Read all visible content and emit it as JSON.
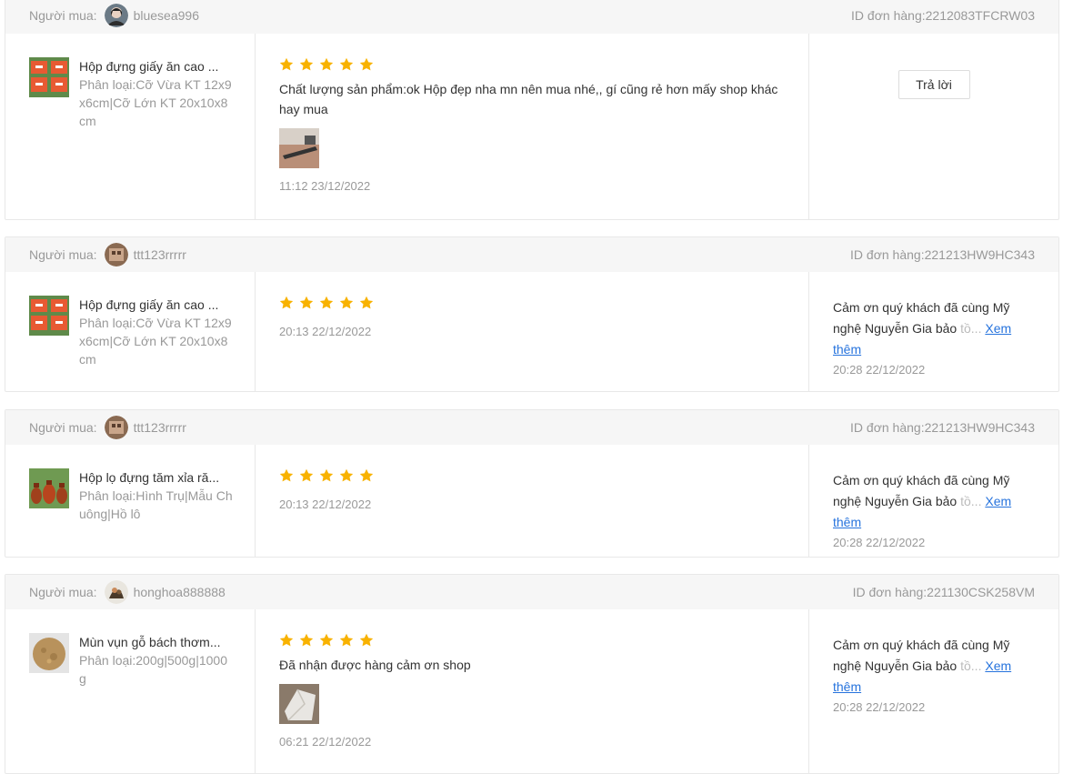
{
  "labels": {
    "buyer": "Người mua:",
    "order_prefix": "ID đơn hàng:",
    "reply_button": "Trả lời",
    "see_more": "Xem thêm"
  },
  "colors": {
    "star": "#f8b200",
    "link": "#2673dd"
  },
  "reviews": [
    {
      "buyer": "bluesea996",
      "order_id": "2212083TFCRW03",
      "product_name": "Hộp đựng giấy ăn cao ...",
      "variant": "Phân loại:Cỡ Vừa KT 12x9x6cm|Cỡ Lớn KT 20x10x8cm",
      "stars": 5,
      "text": "Chất lượng sản phẩm:ok Hộp đẹp nha mn nên mua nhé,, gí cũng rẻ hơn mấy shop khác hay mua",
      "has_image": true,
      "time": "11:12 23/12/2022",
      "reply": null
    },
    {
      "buyer": "ttt123rrrrr",
      "order_id": "221213HW9HC343",
      "product_name": "Hộp đựng giấy ăn cao ...",
      "variant": "Phân loại:Cỡ Vừa KT 12x9x6cm|Cỡ Lớn KT 20x10x8cm",
      "stars": 5,
      "text": "",
      "has_image": false,
      "time": "20:13 22/12/2022",
      "reply": {
        "text": "Cảm ơn quý khách đã cùng Mỹ nghệ Nguyễn Gia bảo ",
        "faded": "tồ...",
        "time": "20:28 22/12/2022"
      }
    },
    {
      "buyer": "ttt123rrrrr",
      "order_id": "221213HW9HC343",
      "product_name": "Hộp lọ đựng tăm xỉa ră...",
      "variant": "Phân loại:Hình Trụ|Mẫu Chuông|Hồ lô",
      "stars": 5,
      "text": "",
      "has_image": false,
      "time": "20:13 22/12/2022",
      "reply": {
        "text": "Cảm ơn quý khách đã cùng Mỹ nghệ Nguyễn Gia bảo ",
        "faded": "tồ...",
        "time": "20:28 22/12/2022"
      }
    },
    {
      "buyer": "honghoa888888",
      "order_id": "221130CSK258VM",
      "product_name": "Mùn vụn gỗ bách thơm...",
      "variant": "Phân loại:200g|500g|1000g",
      "stars": 5,
      "text": "Đã nhận được hàng cảm ơn shop",
      "has_image": true,
      "time": "06:21 22/12/2022",
      "reply": {
        "text": "Cảm ơn quý khách đã cùng Mỹ nghệ Nguyễn Gia bảo ",
        "faded": "tồ...",
        "time": "20:28 22/12/2022"
      }
    }
  ]
}
